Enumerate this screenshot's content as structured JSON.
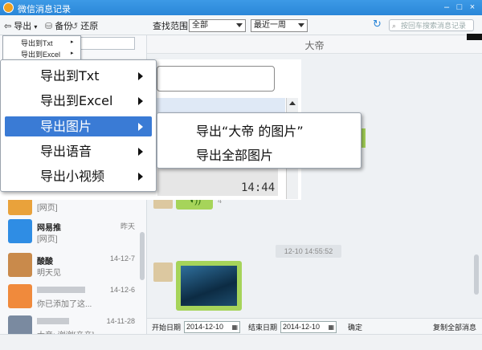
{
  "window": {
    "title": "微信消息记录",
    "min": "–",
    "max": "□",
    "close": "×"
  },
  "toolbar": {
    "export_label": "导出",
    "backup_label": "备份",
    "restore_label": "还原",
    "range_label": "查找范围:",
    "range_value": "全部",
    "period_value": "最近一周",
    "search_placeholder": "按回车搜索消息记录"
  },
  "export_menu_small": {
    "items": [
      "导出到Txt",
      "导出到Excel"
    ]
  },
  "export_menu_zoom": {
    "items": [
      {
        "label": "导出到Txt",
        "highlighted": false
      },
      {
        "label": "导出到Excel",
        "highlighted": false
      },
      {
        "label": "导出图片",
        "highlighted": true
      },
      {
        "label": "导出语音",
        "highlighted": false
      },
      {
        "label": "导出小视频",
        "highlighted": false
      }
    ],
    "submenu": [
      "导出“大帝 的图片”",
      "导出全部图片"
    ]
  },
  "inset_chat": {
    "time": "14:44"
  },
  "contacts": [
    {
      "name": "",
      "message": "[网页]",
      "date": "",
      "color": "#e9a23b"
    },
    {
      "name": "网易推",
      "message": "[网页]",
      "date": "昨天",
      "color": "#2f8de4"
    },
    {
      "name": "酸酸",
      "message": "明天见",
      "date": "14-12-7",
      "color": "#c98a4b"
    },
    {
      "name": "",
      "message": "你已添加了这...",
      "date": "14-12-6",
      "color": "#f08a3c"
    },
    {
      "name": "",
      "message": "大帝: 谢谢[亲亲]",
      "date": "14-11-28",
      "color": "#7a8aa0"
    }
  ],
  "chat": {
    "contact_name": "大帝",
    "voice_duration": "4″",
    "timestamp": "12-10 14:55:52"
  },
  "bottom": {
    "start_label": "开始日期",
    "start_date": "2014-12-10",
    "end_label": "结束日期",
    "end_date": "2014-12-10",
    "confirm": "确定",
    "copy_all": "复制全部消息"
  }
}
